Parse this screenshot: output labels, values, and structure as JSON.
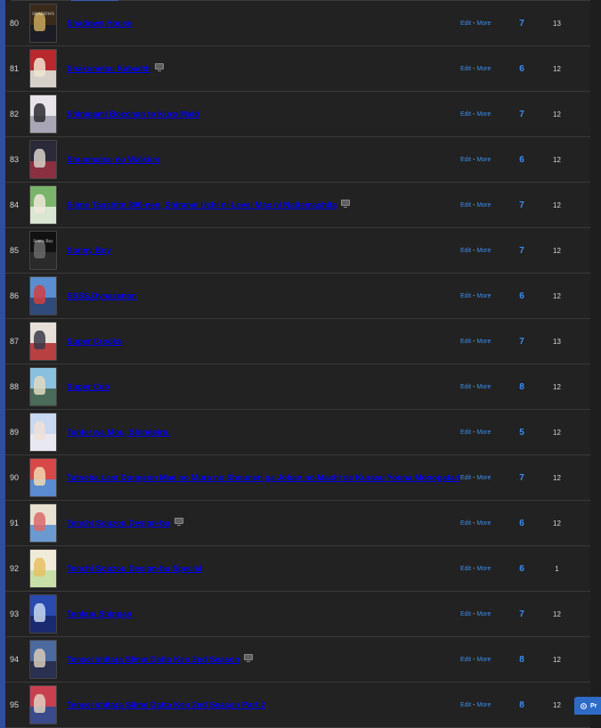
{
  "anime_list": {
    "rows": [
      {
        "num": "80",
        "title": "Shadows House",
        "tv_icon": false,
        "score": "7",
        "episodes": "13",
        "poster": {
          "c1": "#3a2a1a",
          "c2": "#1c1c24",
          "c3": "#c9a85a",
          "text": "SHADOWS"
        }
      },
      {
        "num": "81",
        "title": "Shakunetsu Kabaddi",
        "tv_icon": true,
        "score": "6",
        "episodes": "12",
        "poster": {
          "c1": "#b8282c",
          "c2": "#d6d0c8",
          "c3": "#f0e3d0",
          "text": ""
        }
      },
      {
        "num": "82",
        "title": "Shinigami Bocchan to Kuro Maid",
        "tv_icon": false,
        "score": "7",
        "episodes": "12",
        "poster": {
          "c1": "#e8e3ea",
          "c2": "#a8a6b6",
          "c3": "#2a2a30",
          "text": ""
        }
      },
      {
        "num": "83",
        "title": "Shuumatsu no Walküre",
        "tv_icon": false,
        "score": "6",
        "episodes": "12",
        "poster": {
          "c1": "#2a2a3a",
          "c2": "#8a3040",
          "c3": "#d8d0c8",
          "text": ""
        }
      },
      {
        "num": "84",
        "title": "Slime Taoshite 300-nen, Shiranai Uchi ni Level Max ni Nattemashita",
        "tv_icon": true,
        "score": "7",
        "episodes": "12",
        "poster": {
          "c1": "#7ab46a",
          "c2": "#d8e6d2",
          "c3": "#f2e8da",
          "text": ""
        }
      },
      {
        "num": "85",
        "title": "Sonny Boy",
        "tv_icon": false,
        "score": "7",
        "episodes": "12",
        "poster": {
          "c1": "#111111",
          "c2": "#2a2a2a",
          "c3": "#6a6a6a",
          "text": "Sonny Boy"
        }
      },
      {
        "num": "86",
        "title": "SSSS.Dynazenon",
        "tv_icon": false,
        "score": "6",
        "episodes": "12",
        "poster": {
          "c1": "#5a8ed0",
          "c2": "#304a7a",
          "c3": "#d04040",
          "text": ""
        }
      },
      {
        "num": "87",
        "title": "Super Crooks",
        "tv_icon": false,
        "score": "7",
        "episodes": "13",
        "poster": {
          "c1": "#e6e0d8",
          "c2": "#b84040",
          "c3": "#3a3a4a",
          "text": ""
        }
      },
      {
        "num": "88",
        "title": "Super Cub",
        "tv_icon": false,
        "score": "8",
        "episodes": "12",
        "poster": {
          "c1": "#8ac0e0",
          "c2": "#4a6a5a",
          "c3": "#e0d8c0",
          "text": ""
        }
      },
      {
        "num": "89",
        "title": "Tantei wa Mou, Shindeiru.",
        "tv_icon": false,
        "score": "5",
        "episodes": "12",
        "poster": {
          "c1": "#c8d8f0",
          "c2": "#e8e8f0",
          "c3": "#f0e0d8",
          "text": ""
        }
      },
      {
        "num": "90",
        "title": "Tatoeba Last Dungeon Mae no Mura no Shounen ga Joban no Machi de Kurasu Youna Monogatari",
        "tv_icon": false,
        "score": "7",
        "episodes": "12",
        "poster": {
          "c1": "#d84848",
          "c2": "#5a8ad0",
          "c3": "#f0d8b0",
          "text": ""
        }
      },
      {
        "num": "91",
        "title": "Tenchi Souzou Design-bu",
        "tv_icon": true,
        "score": "6",
        "episodes": "12",
        "poster": {
          "c1": "#e8e0d0",
          "c2": "#6a9ad0",
          "c3": "#d86a6a",
          "text": ""
        }
      },
      {
        "num": "92",
        "title": "Tenchi Souzou Design-bu Special",
        "tv_icon": false,
        "score": "6",
        "episodes": "1",
        "poster": {
          "c1": "#f0ead8",
          "c2": "#c8e0a8",
          "c3": "#e8c060",
          "text": ""
        }
      },
      {
        "num": "93",
        "title": "Tenkuu Shinpan",
        "tv_icon": false,
        "score": "7",
        "episodes": "12",
        "poster": {
          "c1": "#2a4ab0",
          "c2": "#1a2a70",
          "c3": "#c8d8f0",
          "text": ""
        }
      },
      {
        "num": "94",
        "title": "Tensei shitara Slime Datta Ken 2nd Season",
        "tv_icon": true,
        "score": "8",
        "episodes": "12",
        "poster": {
          "c1": "#4a6aa0",
          "c2": "#2a3050",
          "c3": "#d8c8b8",
          "text": ""
        }
      },
      {
        "num": "95",
        "title": "Tensei shitara Slime Datta Ken 2nd Season Part 2",
        "tv_icon": false,
        "score": "8",
        "episodes": "12",
        "poster": {
          "c1": "#c84050",
          "c2": "#3a4a8a",
          "c3": "#e0d0c0",
          "text": ""
        }
      }
    ],
    "edit_label": "Edit",
    "separator": "-",
    "more_label": "More"
  },
  "preferences_button": {
    "label": "Pr"
  },
  "colors": {
    "link": "#3c8ef0",
    "accent_bar": "#2d4f9c",
    "background": "#1e1e1e"
  }
}
